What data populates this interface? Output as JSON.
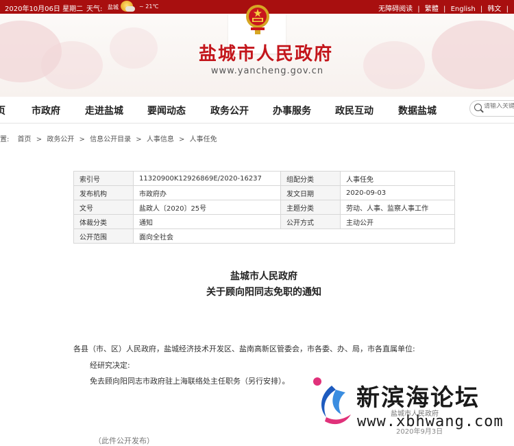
{
  "topbar": {
    "date": "2020年10月06日 星期二",
    "weather_label": "天气:",
    "weather_city": "盐城",
    "temperature": "~ 21℃",
    "links": [
      "无障碍阅读",
      "|",
      "繁體",
      "|",
      "English",
      "|",
      "韩文",
      "|"
    ]
  },
  "header": {
    "title": "盐城市人民政府",
    "url": "www.yancheng.gov.cn"
  },
  "nav": {
    "items": [
      "页",
      "市政府",
      "走进盐城",
      "要闻动态",
      "政务公开",
      "办事服务",
      "政民互动",
      "数据盐城"
    ]
  },
  "search": {
    "placeholder": "请输入关键"
  },
  "breadcrumb": {
    "prefix": "置:",
    "items": [
      "首页",
      "政务公开",
      "信息公开目录",
      "人事信息",
      "人事任免"
    ]
  },
  "meta": {
    "rows": [
      [
        "索引号",
        "11320900K12926869E/2020-16237",
        "组配分类",
        "人事任免"
      ],
      [
        "发布机构",
        "市政府办",
        "发文日期",
        "2020-09-03"
      ],
      [
        "文号",
        "盐政人〔2020〕25号",
        "主题分类",
        "劳动、人事、监察人事工作"
      ],
      [
        "体裁分类",
        "通知",
        "公开方式",
        "主动公开"
      ],
      [
        "公开范围",
        "面向全社会"
      ]
    ]
  },
  "document": {
    "title_line1": "盐城市人民政府",
    "title_line2": "关于顾向阳同志免职的通知",
    "addressee": "各县（市、区）人民政府，盐城经济技术开发区、盐南高新区管委会，市各委、办、局，市各直属单位:",
    "para1": "经研究决定:",
    "para2": "免去顾向阳同志市政府驻上海联络处主任职务（另行安排）。",
    "signature": "盐城市人民政府",
    "date": "2020年9月3日",
    "remark": "（此件公开发布）"
  },
  "watermark": {
    "name": "新滨海论坛",
    "url": "www.xbhwang.com"
  },
  "colors": {
    "accent_red": "#a80f0f",
    "title_red": "#c3151b",
    "watermark_blue": "#1d5bbf"
  }
}
